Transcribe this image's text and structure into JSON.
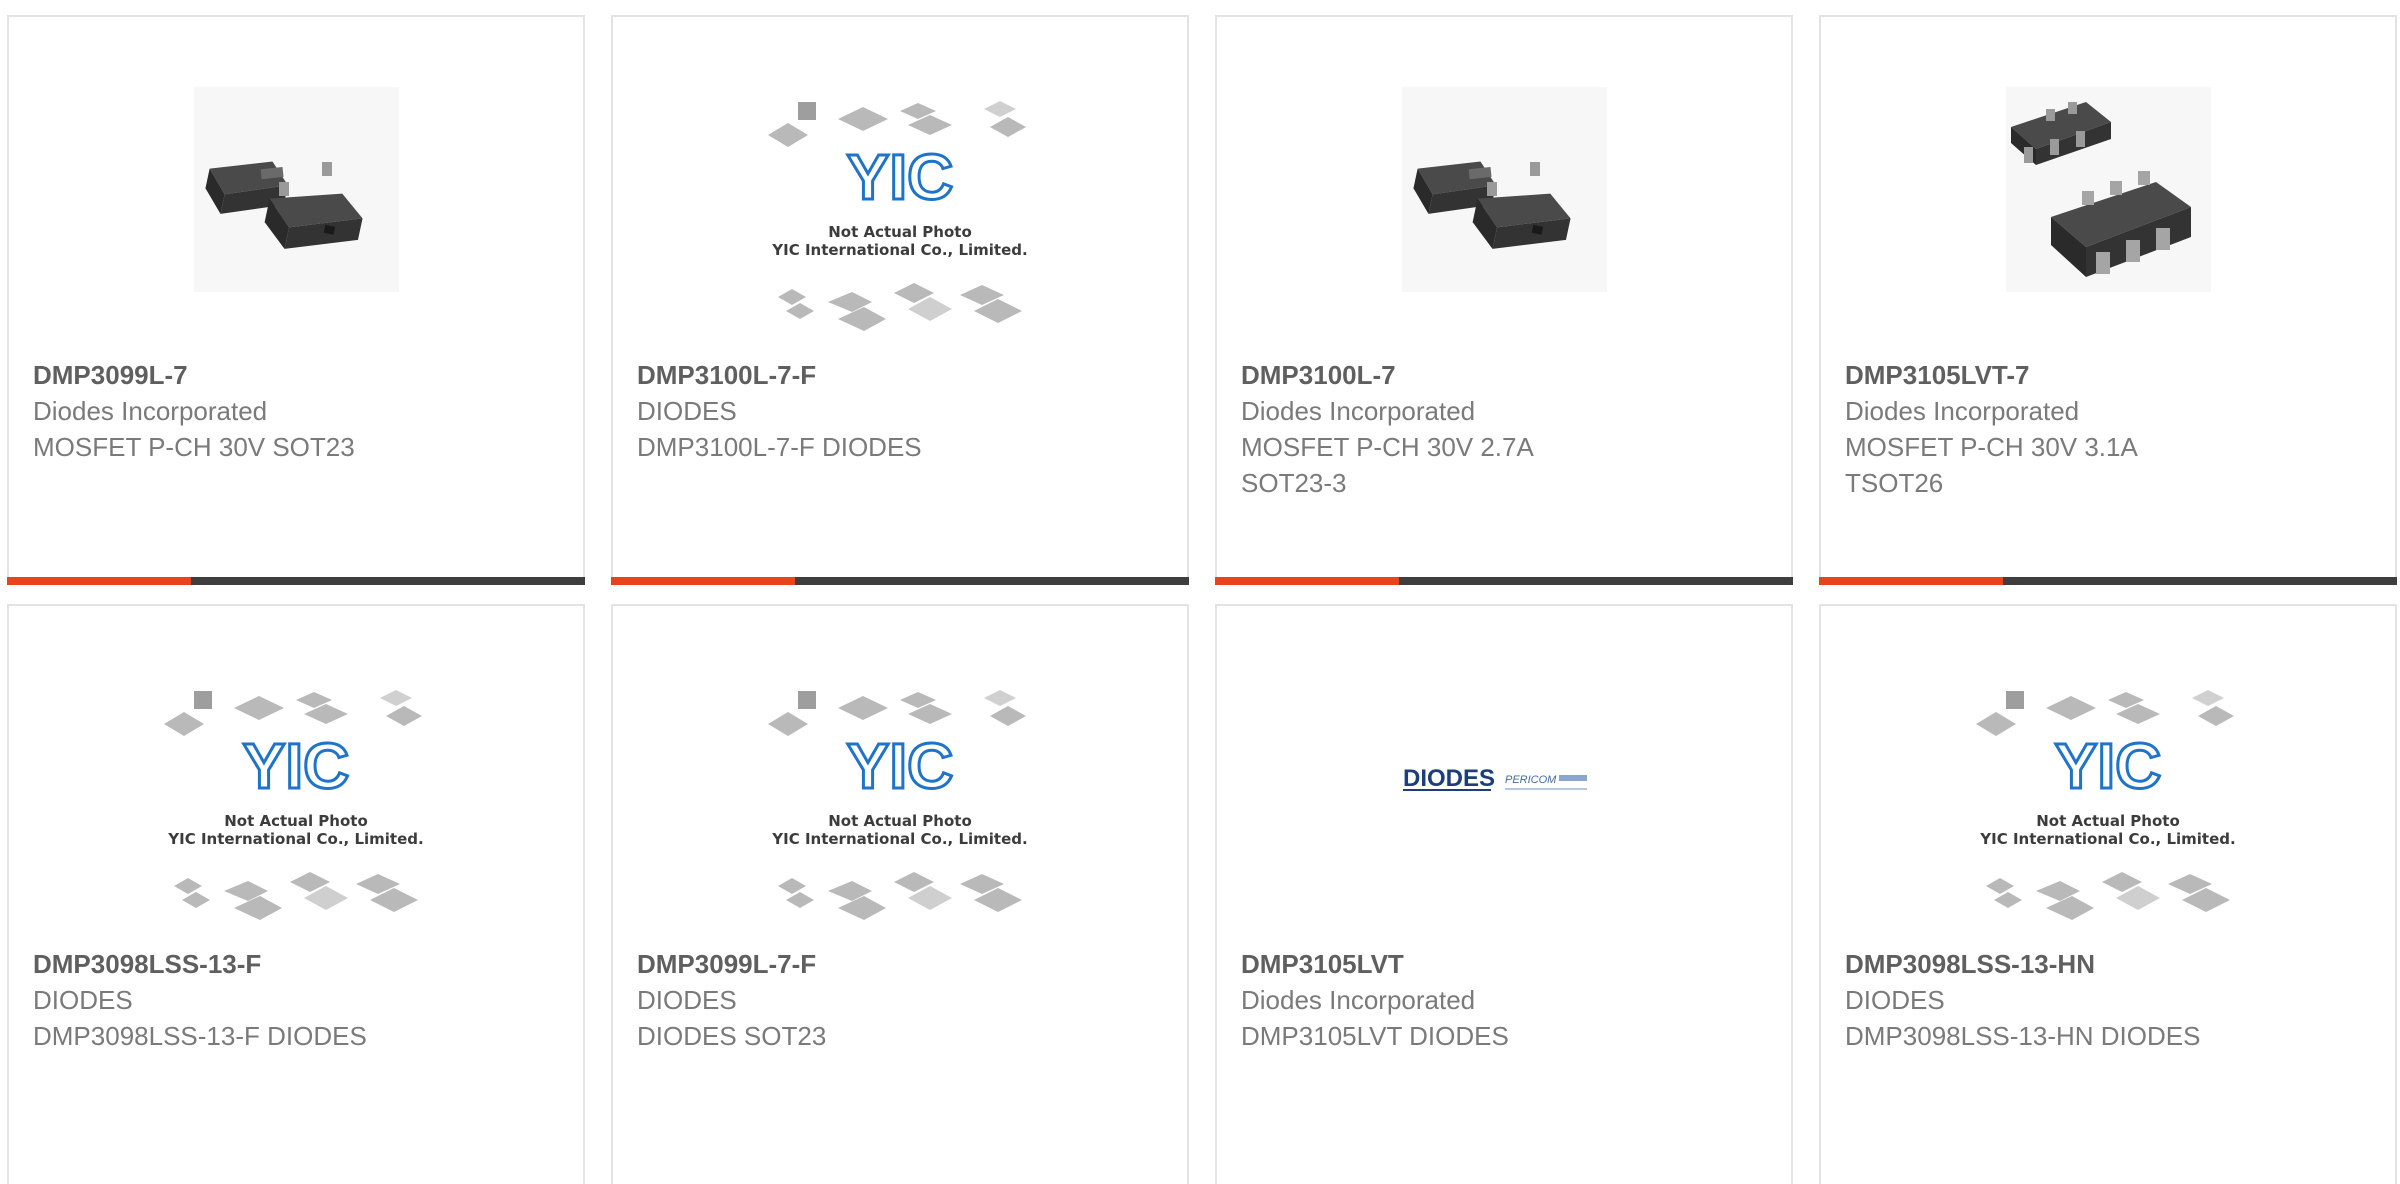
{
  "theme": {
    "accent": "#e8431f",
    "bar": "#3e3e3e",
    "part_color": "#5f5f5f",
    "text_color": "#7a7a7a",
    "yic_blue": "#1f73c8"
  },
  "placeholder": {
    "line1": "Not Actual Photo",
    "line2": "YIC International Co., Limited.",
    "logo": "YIC"
  },
  "products": [
    {
      "part": "DMP3099L-7",
      "manufacturer": "Diodes Incorporated",
      "description": "MOSFET P-CH 30V SOT23",
      "image": "sot23-package-photo"
    },
    {
      "part": "DMP3100L-7-F",
      "manufacturer": "DIODES",
      "description": "DMP3100L-7-F DIODES",
      "image": "yic-placeholder"
    },
    {
      "part": "DMP3100L-7",
      "manufacturer": "Diodes Incorporated",
      "description": "MOSFET P-CH 30V 2.7A\nSOT23-3",
      "image": "sot23-package-photo"
    },
    {
      "part": "DMP3105LVT-7",
      "manufacturer": "Diodes Incorporated",
      "description": "MOSFET P-CH 30V 3.1A\nTSOT26",
      "image": "tsot26-package-photo"
    },
    {
      "part": "DMP3098LSS-13-F",
      "manufacturer": "DIODES",
      "description": "DMP3098LSS-13-F DIODES",
      "image": "yic-placeholder"
    },
    {
      "part": "DMP3099L-7-F",
      "manufacturer": "DIODES",
      "description": "DIODES SOT23",
      "image": "yic-placeholder"
    },
    {
      "part": "DMP3105LVT",
      "manufacturer": "Diodes Incorporated",
      "description": "DMP3105LVT DIODES",
      "image": "diodes-pericom-logo",
      "logo_text": [
        "DIODES",
        "PERICOM"
      ]
    },
    {
      "part": "DMP3098LSS-13-HN",
      "manufacturer": "DIODES",
      "description": "DMP3098LSS-13-HN DIODES",
      "image": "yic-placeholder"
    }
  ]
}
